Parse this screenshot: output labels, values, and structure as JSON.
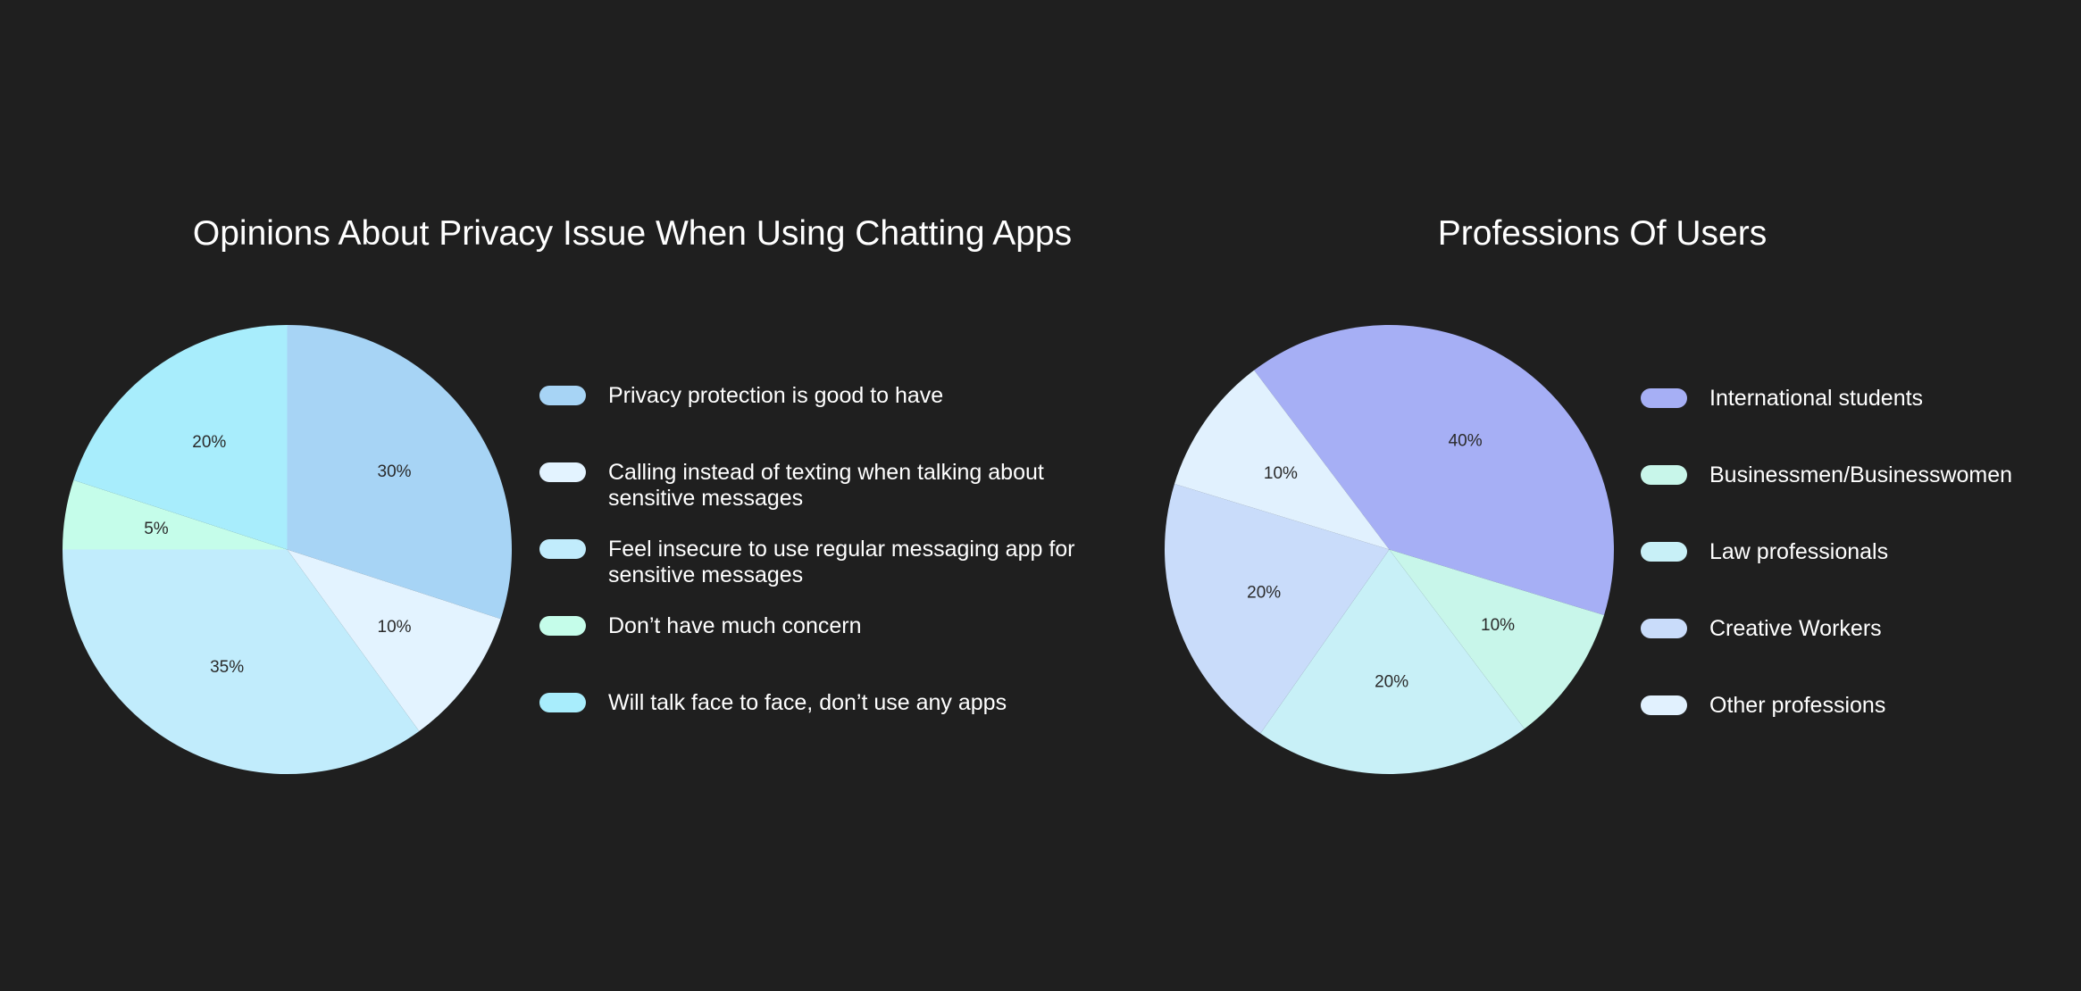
{
  "chart_data": [
    {
      "type": "pie",
      "title": "Opinions About Privacy Issue When Using Chatting Apps",
      "categories": [
        "Privacy protection is good to have",
        "Calling instead of texting when talking about sensitive messages",
        "Feel insecure to use regular messaging app for sensitive messages",
        "Don’t have much concern",
        "Will talk face to face, don’t use any apps"
      ],
      "values": [
        30,
        10,
        35,
        5,
        20
      ],
      "value_labels": [
        "30%",
        "10%",
        "35%",
        "5%",
        "20%"
      ],
      "colors": [
        "#a7d4f5",
        "#e3f3ff",
        "#c1ecfc",
        "#c5fdea",
        "#a8edfc"
      ],
      "legend_placement": "right"
    },
    {
      "type": "pie",
      "title": "Professions Of Users",
      "categories": [
        "International students",
        "Businessmen/Businesswomen",
        "Law professionals",
        "Creative Workers",
        "Other professions"
      ],
      "values": [
        40,
        10,
        20,
        20,
        10
      ],
      "value_labels": [
        "40%",
        "10%",
        "20%",
        "20%",
        "10%"
      ],
      "colors": [
        "#a6aff5",
        "#c8f6ea",
        "#c8f0f7",
        "#c9dcfa",
        "#e1f1fe"
      ],
      "legend_placement": "right"
    }
  ]
}
